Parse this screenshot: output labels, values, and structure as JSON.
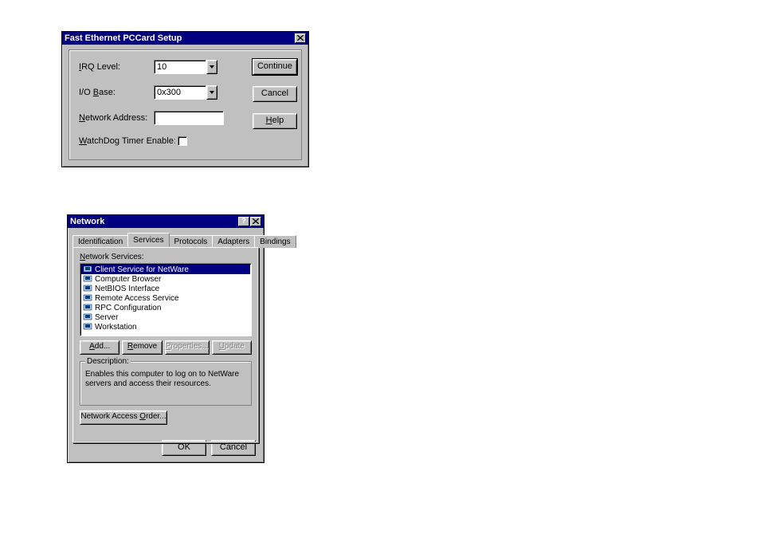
{
  "w1": {
    "title": "Fast Ethernet PCCard Setup",
    "labels": {
      "irq_I": "I",
      "irq_rest": "RQ Level:",
      "iob_1": "I/O ",
      "iob_B": "B",
      "iob_rest": "ase:",
      "net_N": "N",
      "net_rest": "etwork Address:",
      "wdt_W": "W",
      "wdt_rest": "atchDog Timer Enable:"
    },
    "values": {
      "irq": "10",
      "io_base": "0x300",
      "network_address": ""
    },
    "buttons": {
      "continue": "Continue",
      "cancel": "Cancel",
      "help_H": "H",
      "help_rest": "elp"
    }
  },
  "w2": {
    "title": "Network",
    "tabs": {
      "identification": "Identification",
      "services": "Services",
      "protocols": "Protocols",
      "adapters": "Adapters",
      "bindings": "Bindings"
    },
    "label_N": "N",
    "label_rest": "etwork Services:",
    "services": [
      "Client Service for NetWare",
      "Computer Browser",
      "NetBIOS Interface",
      "Remote Access Service",
      "RPC Configuration",
      "Server",
      "Workstation"
    ],
    "buttons": {
      "add_A": "A",
      "add_rest": "dd...",
      "remove_R": "R",
      "remove_rest": "emove",
      "properties_P": "P",
      "properties_rest": "roperties...",
      "update_U": "U",
      "update_rest": "pdate"
    },
    "description": {
      "legend": "Description:",
      "text": "Enables this computer to log on to NetWare servers and access their resources."
    },
    "nao_pre": "Network Access ",
    "nao_O": "O",
    "nao_rest": "rder...",
    "ok": "OK",
    "cancel": "Cancel"
  }
}
